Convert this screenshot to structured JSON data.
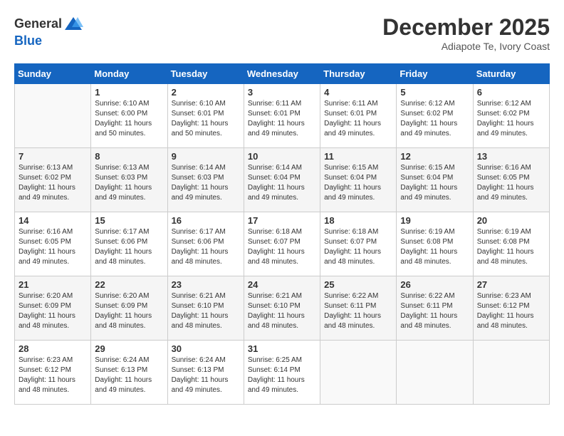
{
  "logo": {
    "general": "General",
    "blue": "Blue"
  },
  "title": "December 2025",
  "subtitle": "Adiapote Te, Ivory Coast",
  "days_header": [
    "Sunday",
    "Monday",
    "Tuesday",
    "Wednesday",
    "Thursday",
    "Friday",
    "Saturday"
  ],
  "weeks": [
    [
      {
        "day": "",
        "sunrise": "",
        "sunset": "",
        "daylight": ""
      },
      {
        "day": "1",
        "sunrise": "Sunrise: 6:10 AM",
        "sunset": "Sunset: 6:00 PM",
        "daylight": "Daylight: 11 hours and 50 minutes."
      },
      {
        "day": "2",
        "sunrise": "Sunrise: 6:10 AM",
        "sunset": "Sunset: 6:01 PM",
        "daylight": "Daylight: 11 hours and 50 minutes."
      },
      {
        "day": "3",
        "sunrise": "Sunrise: 6:11 AM",
        "sunset": "Sunset: 6:01 PM",
        "daylight": "Daylight: 11 hours and 49 minutes."
      },
      {
        "day": "4",
        "sunrise": "Sunrise: 6:11 AM",
        "sunset": "Sunset: 6:01 PM",
        "daylight": "Daylight: 11 hours and 49 minutes."
      },
      {
        "day": "5",
        "sunrise": "Sunrise: 6:12 AM",
        "sunset": "Sunset: 6:02 PM",
        "daylight": "Daylight: 11 hours and 49 minutes."
      },
      {
        "day": "6",
        "sunrise": "Sunrise: 6:12 AM",
        "sunset": "Sunset: 6:02 PM",
        "daylight": "Daylight: 11 hours and 49 minutes."
      }
    ],
    [
      {
        "day": "7",
        "sunrise": "Sunrise: 6:13 AM",
        "sunset": "Sunset: 6:02 PM",
        "daylight": "Daylight: 11 hours and 49 minutes."
      },
      {
        "day": "8",
        "sunrise": "Sunrise: 6:13 AM",
        "sunset": "Sunset: 6:03 PM",
        "daylight": "Daylight: 11 hours and 49 minutes."
      },
      {
        "day": "9",
        "sunrise": "Sunrise: 6:14 AM",
        "sunset": "Sunset: 6:03 PM",
        "daylight": "Daylight: 11 hours and 49 minutes."
      },
      {
        "day": "10",
        "sunrise": "Sunrise: 6:14 AM",
        "sunset": "Sunset: 6:04 PM",
        "daylight": "Daylight: 11 hours and 49 minutes."
      },
      {
        "day": "11",
        "sunrise": "Sunrise: 6:15 AM",
        "sunset": "Sunset: 6:04 PM",
        "daylight": "Daylight: 11 hours and 49 minutes."
      },
      {
        "day": "12",
        "sunrise": "Sunrise: 6:15 AM",
        "sunset": "Sunset: 6:04 PM",
        "daylight": "Daylight: 11 hours and 49 minutes."
      },
      {
        "day": "13",
        "sunrise": "Sunrise: 6:16 AM",
        "sunset": "Sunset: 6:05 PM",
        "daylight": "Daylight: 11 hours and 49 minutes."
      }
    ],
    [
      {
        "day": "14",
        "sunrise": "Sunrise: 6:16 AM",
        "sunset": "Sunset: 6:05 PM",
        "daylight": "Daylight: 11 hours and 49 minutes."
      },
      {
        "day": "15",
        "sunrise": "Sunrise: 6:17 AM",
        "sunset": "Sunset: 6:06 PM",
        "daylight": "Daylight: 11 hours and 48 minutes."
      },
      {
        "day": "16",
        "sunrise": "Sunrise: 6:17 AM",
        "sunset": "Sunset: 6:06 PM",
        "daylight": "Daylight: 11 hours and 48 minutes."
      },
      {
        "day": "17",
        "sunrise": "Sunrise: 6:18 AM",
        "sunset": "Sunset: 6:07 PM",
        "daylight": "Daylight: 11 hours and 48 minutes."
      },
      {
        "day": "18",
        "sunrise": "Sunrise: 6:18 AM",
        "sunset": "Sunset: 6:07 PM",
        "daylight": "Daylight: 11 hours and 48 minutes."
      },
      {
        "day": "19",
        "sunrise": "Sunrise: 6:19 AM",
        "sunset": "Sunset: 6:08 PM",
        "daylight": "Daylight: 11 hours and 48 minutes."
      },
      {
        "day": "20",
        "sunrise": "Sunrise: 6:19 AM",
        "sunset": "Sunset: 6:08 PM",
        "daylight": "Daylight: 11 hours and 48 minutes."
      }
    ],
    [
      {
        "day": "21",
        "sunrise": "Sunrise: 6:20 AM",
        "sunset": "Sunset: 6:09 PM",
        "daylight": "Daylight: 11 hours and 48 minutes."
      },
      {
        "day": "22",
        "sunrise": "Sunrise: 6:20 AM",
        "sunset": "Sunset: 6:09 PM",
        "daylight": "Daylight: 11 hours and 48 minutes."
      },
      {
        "day": "23",
        "sunrise": "Sunrise: 6:21 AM",
        "sunset": "Sunset: 6:10 PM",
        "daylight": "Daylight: 11 hours and 48 minutes."
      },
      {
        "day": "24",
        "sunrise": "Sunrise: 6:21 AM",
        "sunset": "Sunset: 6:10 PM",
        "daylight": "Daylight: 11 hours and 48 minutes."
      },
      {
        "day": "25",
        "sunrise": "Sunrise: 6:22 AM",
        "sunset": "Sunset: 6:11 PM",
        "daylight": "Daylight: 11 hours and 48 minutes."
      },
      {
        "day": "26",
        "sunrise": "Sunrise: 6:22 AM",
        "sunset": "Sunset: 6:11 PM",
        "daylight": "Daylight: 11 hours and 48 minutes."
      },
      {
        "day": "27",
        "sunrise": "Sunrise: 6:23 AM",
        "sunset": "Sunset: 6:12 PM",
        "daylight": "Daylight: 11 hours and 48 minutes."
      }
    ],
    [
      {
        "day": "28",
        "sunrise": "Sunrise: 6:23 AM",
        "sunset": "Sunset: 6:12 PM",
        "daylight": "Daylight: 11 hours and 48 minutes."
      },
      {
        "day": "29",
        "sunrise": "Sunrise: 6:24 AM",
        "sunset": "Sunset: 6:13 PM",
        "daylight": "Daylight: 11 hours and 49 minutes."
      },
      {
        "day": "30",
        "sunrise": "Sunrise: 6:24 AM",
        "sunset": "Sunset: 6:13 PM",
        "daylight": "Daylight: 11 hours and 49 minutes."
      },
      {
        "day": "31",
        "sunrise": "Sunrise: 6:25 AM",
        "sunset": "Sunset: 6:14 PM",
        "daylight": "Daylight: 11 hours and 49 minutes."
      },
      {
        "day": "",
        "sunrise": "",
        "sunset": "",
        "daylight": ""
      },
      {
        "day": "",
        "sunrise": "",
        "sunset": "",
        "daylight": ""
      },
      {
        "day": "",
        "sunrise": "",
        "sunset": "",
        "daylight": ""
      }
    ]
  ]
}
